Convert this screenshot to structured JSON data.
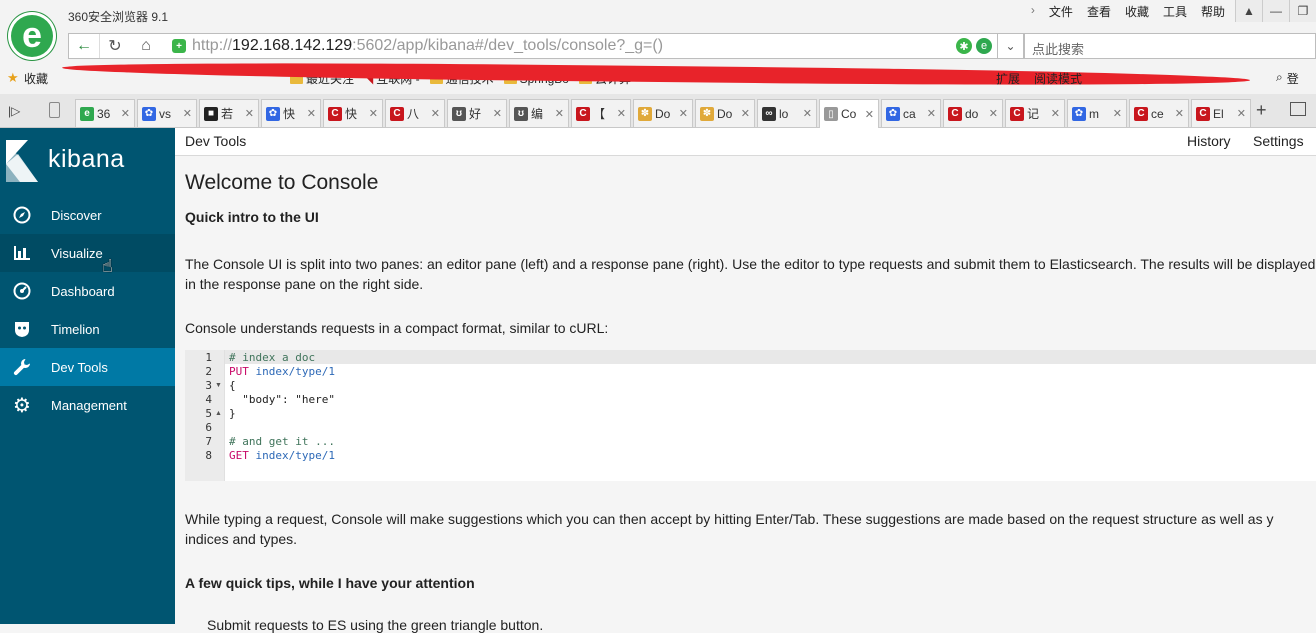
{
  "browser": {
    "title": "360安全浏览器 9.1",
    "menu": [
      "文件",
      "查看",
      "收藏",
      "工具",
      "帮助"
    ],
    "url_scheme": "http://",
    "url_host": "192.168.142.129",
    "url_rest": ":5602/app/kibana#/dev_tools/console?_g=()",
    "search_placeholder": "点此搜索",
    "bookmarks_label": "收藏",
    "bookmarks": [
      "最近关注",
      "互联网 -",
      "通信技术",
      "SpringBo",
      "云计算"
    ],
    "bookmarks_right": [
      "扩展",
      "阅读模式"
    ],
    "bookmarks_right2": "登",
    "tabs": [
      {
        "label": "36",
        "color": "#2fa84f",
        "glyph": "e"
      },
      {
        "label": "vs",
        "color": "#3267e3",
        "glyph": "✿"
      },
      {
        "label": "若",
        "color": "#222222",
        "glyph": "■"
      },
      {
        "label": "快",
        "color": "#3267e3",
        "glyph": "✿"
      },
      {
        "label": "快",
        "color": "#c8161d",
        "glyph": "C"
      },
      {
        "label": "八",
        "color": "#c8161d",
        "glyph": "C"
      },
      {
        "label": "好",
        "color": "#555555",
        "glyph": "ʊ"
      },
      {
        "label": "编",
        "color": "#555555",
        "glyph": "ʊ"
      },
      {
        "label": "【",
        "color": "#c8161d",
        "glyph": "C"
      },
      {
        "label": "Do",
        "color": "#e0a93a",
        "glyph": "✽"
      },
      {
        "label": "Do",
        "color": "#e0a93a",
        "glyph": "✽"
      },
      {
        "label": "lo",
        "color": "#333333",
        "glyph": "∞"
      },
      {
        "label": "Co",
        "color": "#999999",
        "glyph": "▯"
      },
      {
        "label": "ca",
        "color": "#3267e3",
        "glyph": "✿"
      },
      {
        "label": "do",
        "color": "#c8161d",
        "glyph": "C"
      },
      {
        "label": "记",
        "color": "#c8161d",
        "glyph": "C"
      },
      {
        "label": "m",
        "color": "#3267e3",
        "glyph": "✿"
      },
      {
        "label": "ce",
        "color": "#c8161d",
        "glyph": "C"
      },
      {
        "label": "El",
        "color": "#c8161d",
        "glyph": "C"
      }
    ]
  },
  "kibana": {
    "brand": "kibana",
    "nav": [
      {
        "label": "Discover",
        "icon": "compass-icon"
      },
      {
        "label": "Visualize",
        "icon": "bar-chart-icon"
      },
      {
        "label": "Dashboard",
        "icon": "dashboard-icon"
      },
      {
        "label": "Timelion",
        "icon": "timelion-icon"
      },
      {
        "label": "Dev Tools",
        "icon": "wrench-icon"
      },
      {
        "label": "Management",
        "icon": "gear-icon"
      }
    ]
  },
  "content": {
    "app_title": "Dev Tools",
    "history": "History",
    "settings": "Settings",
    "welcome": "Welcome to Console",
    "quick_intro": "Quick intro to the UI",
    "para1": "The Console UI is split into two panes: an editor pane (left) and a response pane (right). Use the editor to type requests and submit them to Elasticsearch. The results will be displayed in the response pane on the right side.",
    "para2": "Console understands requests in a compact format, similar to cURL:",
    "code_lines": [
      "1",
      "2",
      "3",
      "4",
      "5",
      "6",
      "7",
      "8"
    ],
    "code": {
      "l1": "# index a doc",
      "l2_method": "PUT",
      "l2_path": "index/type/1",
      "l3": "{",
      "l4_key": "\"body\"",
      "l4_colon": ": ",
      "l4_val": "\"here\"",
      "l5": "}",
      "l7": "# and get it ...",
      "l8_method": "GET",
      "l8_path": "index/type/1"
    },
    "para3": "While typing a request, Console will make suggestions which you can then accept by hitting Enter/Tab. These suggestions are made based on the request structure as well as y",
    "para3b": "indices and types.",
    "tips": "A few quick tips, while I have your attention",
    "para4": "Submit requests to ES using the green triangle button."
  }
}
